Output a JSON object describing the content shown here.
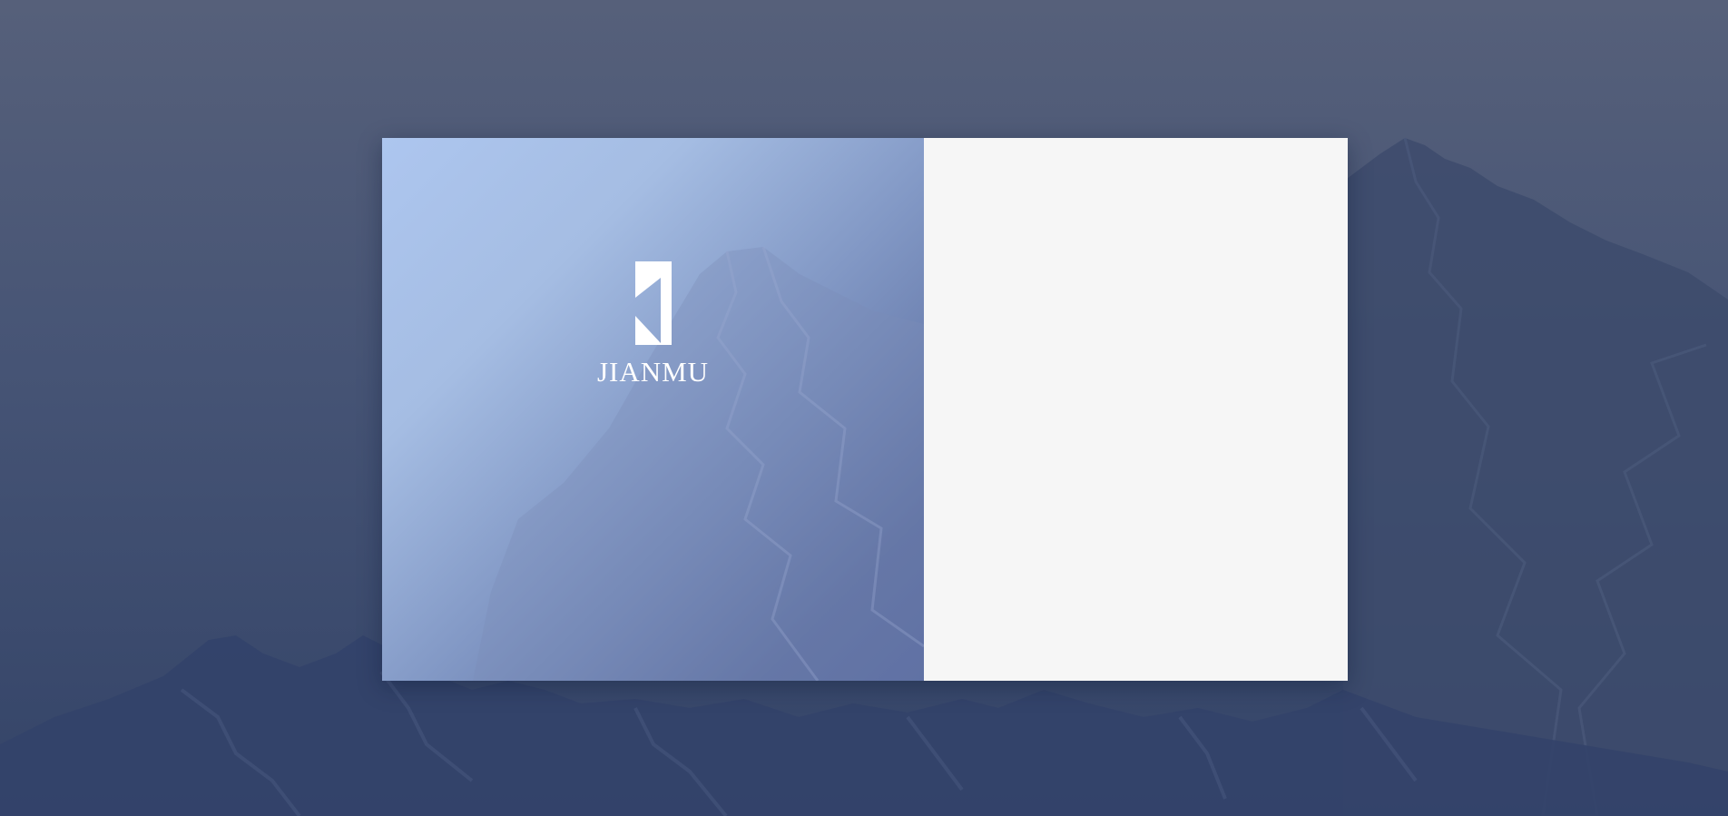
{
  "brand": {
    "name": "JIANMU",
    "logo_icon": "jianmu-logo-icon"
  },
  "colors": {
    "background": "#465475",
    "panel_gradient_start": "#adc6ef",
    "panel_gradient_end": "#52639a",
    "form_panel": "#f6f6f6",
    "logo": "#ffffff"
  }
}
